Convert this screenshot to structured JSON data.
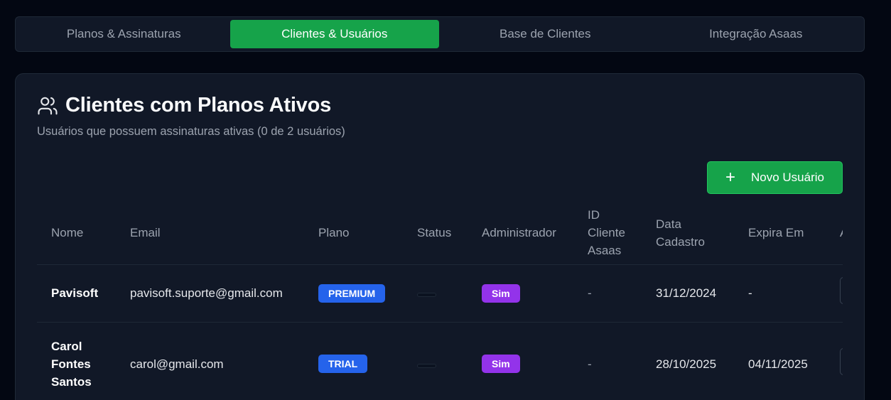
{
  "tabs": [
    {
      "label": "Planos & Assinaturas",
      "active": false
    },
    {
      "label": "Clientes & Usuários",
      "active": true
    },
    {
      "label": "Base de Clientes",
      "active": false
    },
    {
      "label": "Integração Asaas",
      "active": false
    }
  ],
  "card": {
    "icon": "users-icon",
    "title": "Clientes com Planos Ativos",
    "subtitle": "Usuários que possuem assinaturas ativas (0 de 2 usuários)",
    "new_user_button": {
      "icon": "plus-icon",
      "label": "Novo Usuário"
    }
  },
  "table": {
    "headers": {
      "name": "Nome",
      "email": "Email",
      "plan": "Plano",
      "status": "Status",
      "admin": "Administrador",
      "asaas_id": "ID Cliente Asaas",
      "created": "Data Cadastro",
      "expires": "Expira Em",
      "actions": "A"
    },
    "rows": [
      {
        "name": "Pavisoft",
        "email": "pavisoft.suporte@gmail.com",
        "plan": "PREMIUM",
        "status": "",
        "admin": "Sim",
        "asaas_id": "-",
        "created": "31/12/2024",
        "expires": "-"
      },
      {
        "name": "Carol Fontes Santos",
        "email": "carol@gmail.com",
        "plan": "TRIAL",
        "status": "",
        "admin": "Sim",
        "asaas_id": "-",
        "created": "28/10/2025",
        "expires": "04/11/2025"
      }
    ]
  },
  "colors": {
    "background": "#030712",
    "card": "#111827",
    "accent_green": "#16a34a",
    "plan_badge": "#2563eb",
    "admin_badge": "#9333ea"
  }
}
